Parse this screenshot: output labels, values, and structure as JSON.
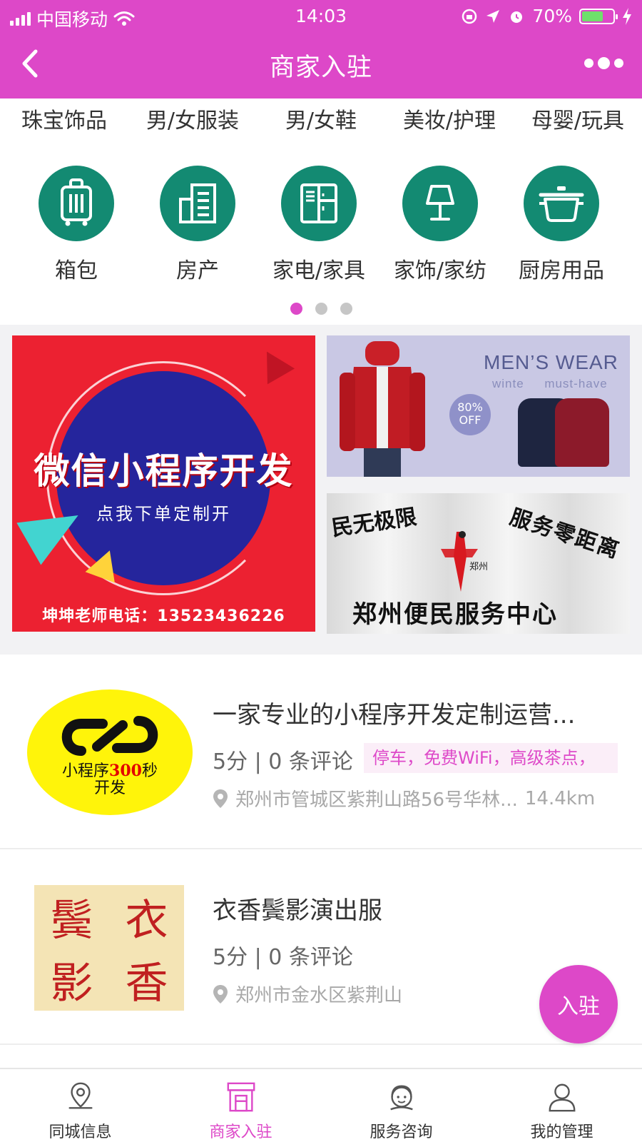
{
  "status_bar": {
    "carrier": "中国移动",
    "time": "14:03",
    "battery_percent": "70%",
    "battery_level": 0.7,
    "battery_color": "#6fe06b"
  },
  "nav": {
    "title": "商家入驻",
    "back_icon": "chevron-left-icon",
    "more_icon": "more-dots-icon"
  },
  "theme": {
    "accent": "#dd48c8",
    "category_icon_bg": "#138a72"
  },
  "categories_text": [
    "珠宝饰品",
    "男/女服装",
    "男/女鞋",
    "美妆/护理",
    "母婴/玩具"
  ],
  "categories_icons": [
    {
      "label": "箱包",
      "icon": "luggage-icon"
    },
    {
      "label": "房产",
      "icon": "building-icon"
    },
    {
      "label": "家电/家具",
      "icon": "fridge-icon"
    },
    {
      "label": "家饰/家纺",
      "icon": "lamp-icon"
    },
    {
      "label": "厨房用品",
      "icon": "pot-icon"
    }
  ],
  "carousel": {
    "page_count": 3,
    "active_index": 0
  },
  "banners": {
    "main": {
      "title": "微信小程序开发",
      "subtitle": "点我下单定制开",
      "phone": "坤坤老师电话：13523436226"
    },
    "mens_wear": {
      "title": "MEN’S WEAR",
      "subtitle_left": "winte",
      "subtitle_right": "must-have",
      "badge_pct": "80%",
      "badge_off": "OFF"
    },
    "service": {
      "left_text": "民无极限",
      "right_text": "服务零距离",
      "logo_text": "郑州",
      "bottom_text": "郑州便民服务中心"
    }
  },
  "listings": [
    {
      "title": "一家专业的小程序开发定制运营...",
      "score": "5分 | 0 条评论",
      "tags": "停车，免费WiFi，高级茶点，",
      "address": "郑州市管城区紫荆山路56号华林...",
      "distance": "14.4km",
      "logo_text_a": "小程序",
      "logo_text_b": "300",
      "logo_text_c": "秒",
      "logo_text_d": "开发"
    },
    {
      "title": "衣香鬓影演出服",
      "score": "5分 | 0 条评论",
      "address": "郑州市金水区紫荆山",
      "logo_chars": [
        "鬓",
        "衣",
        "影",
        "香"
      ]
    }
  ],
  "fab": {
    "label": "入驻"
  },
  "tabbar": [
    {
      "label": "同城信息",
      "icon": "location-pin-icon",
      "active": false
    },
    {
      "label": "商家入驻",
      "icon": "storefront-icon",
      "active": true
    },
    {
      "label": "服务咨询",
      "icon": "customer-service-icon",
      "active": false
    },
    {
      "label": "我的管理",
      "icon": "user-icon",
      "active": false
    }
  ]
}
